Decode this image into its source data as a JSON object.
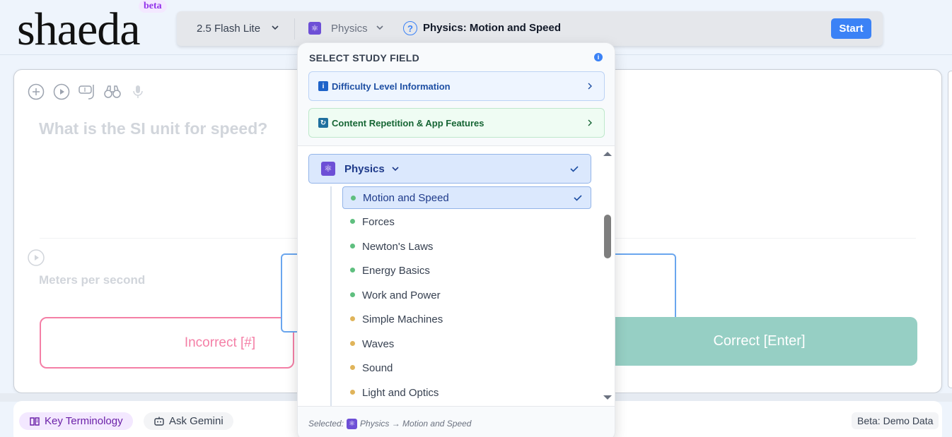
{
  "app": {
    "logo": "shaeda",
    "beta": "beta"
  },
  "top_bar": {
    "model": "2.5 Flash Lite",
    "field": "Physics",
    "topic_title": "Physics: Motion and Speed",
    "start_label": "Start"
  },
  "card": {
    "question": "What is the SI unit for speed?",
    "answer": "Meters per second",
    "incorrect_label": "Incorrect [#]",
    "correct_label": "Correct [Enter]"
  },
  "bottom": {
    "key_terminology": "Key Terminology",
    "ask_gemini": "Ask Gemini",
    "demo_badge": "Beta: Demo Data"
  },
  "dropdown": {
    "title": "SELECT STUDY FIELD",
    "difficulty_card": "Difficulty Level Information",
    "repetition_card": "Content Repetition & App Features",
    "category": "Physics",
    "items": [
      {
        "label": "Motion and Speed",
        "level": "green"
      },
      {
        "label": "Forces",
        "level": "green"
      },
      {
        "label": "Newton's Laws",
        "level": "green"
      },
      {
        "label": "Energy Basics",
        "level": "green"
      },
      {
        "label": "Work and Power",
        "level": "green"
      },
      {
        "label": "Simple Machines",
        "level": "amber"
      },
      {
        "label": "Waves",
        "level": "amber"
      },
      {
        "label": "Sound",
        "level": "amber"
      },
      {
        "label": "Light and Optics",
        "level": "amber"
      }
    ],
    "footer_prefix": "Selected:",
    "footer_path": "Physics → Motion and Speed"
  },
  "colors": {
    "accent": "#3b82f6",
    "green_dot": "#5fbf7f",
    "amber_dot": "#e0b45a",
    "incorrect": "#f47fa6",
    "correct": "#96cfc4"
  }
}
